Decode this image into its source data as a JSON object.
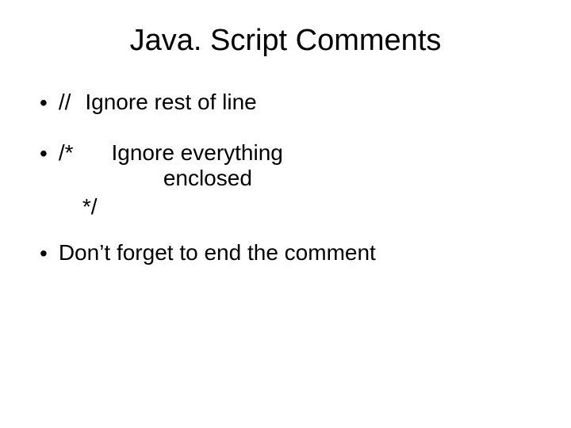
{
  "title": "Java. Script Comments",
  "bullets": {
    "b1": {
      "syntax": "//",
      "text": "Ignore rest of line"
    },
    "b2": {
      "open": "/*",
      "line1": "Ignore everything",
      "line2": "enclosed",
      "close": "*/"
    },
    "b3": {
      "text": "Don’t forget to end the comment"
    }
  }
}
